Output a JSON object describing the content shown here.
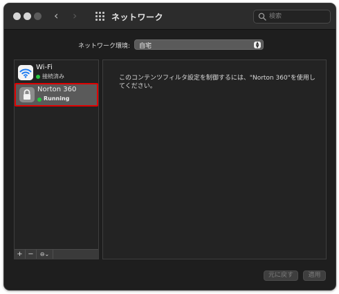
{
  "window": {
    "title": "ネットワーク",
    "search": {
      "placeholder": "検索",
      "value": ""
    }
  },
  "location": {
    "label": "ネットワーク環境:",
    "value": "自宅"
  },
  "sidebar": {
    "services": [
      {
        "name": "Wi-Fi",
        "status": "接続済み",
        "status_color": "#28c840",
        "icon": "wifi-icon"
      },
      {
        "name": "Norton 360",
        "status": "Running",
        "status_color": "#28c840",
        "icon": "lock-icon",
        "selected": true
      }
    ],
    "toolbar": {
      "add": "+",
      "remove": "−",
      "action": "⊖⌄"
    }
  },
  "detail": {
    "message": "このコンテンツフィルタ設定を制御するには、\"Norton 360\"を使用してください。"
  },
  "buttons": {
    "revert": "元に戻す",
    "apply": "適用"
  },
  "colors": {
    "highlight_border": "#e00000",
    "status_green": "#28c840"
  }
}
